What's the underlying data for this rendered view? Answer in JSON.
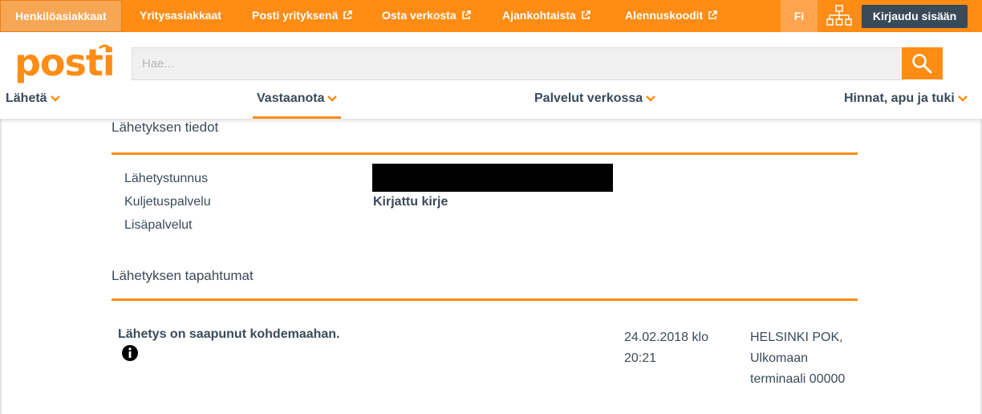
{
  "topbar": {
    "tabs": [
      {
        "label": "Henkilöasiakkaat",
        "external": false,
        "active": true
      },
      {
        "label": "Yritysasiakkaat",
        "external": false,
        "active": false
      },
      {
        "label": "Posti yrityksenä",
        "external": true,
        "active": false
      },
      {
        "label": "Osta verkosta",
        "external": true,
        "active": false
      },
      {
        "label": "Ajankohtaista",
        "external": true,
        "active": false
      },
      {
        "label": "Alennuskoodit",
        "external": true,
        "active": false
      }
    ],
    "language": "Fi",
    "sitemap_icon": "sitemap-icon",
    "login_label": "Kirjaudu sisään"
  },
  "header": {
    "logo_text": "posti",
    "search_placeholder": "Hae...",
    "search_value": "",
    "nav": [
      {
        "label": "Lähetä"
      },
      {
        "label": "Vastaanota",
        "active": true
      },
      {
        "label": "Palvelut verkossa"
      },
      {
        "label": "Hinnat, apu ja tuki"
      }
    ]
  },
  "shipment": {
    "details_title": "Lähetyksen tiedot",
    "fields": [
      {
        "label": "Lähetystunnus",
        "value": "",
        "redacted": true
      },
      {
        "label": "Kuljetuspalvelu",
        "value": "Kirjattu kirje"
      },
      {
        "label": "Lisäpalvelut",
        "value": ""
      }
    ],
    "events_title": "Lähetyksen tapahtumat",
    "events": [
      {
        "title": "Lähetys on saapunut kohdemaahan.",
        "date": "24.02.2018 klo 20:21",
        "location": "HELSINKI POK, Ulkomaan terminaali 00000"
      }
    ]
  },
  "colors": {
    "brand_orange": "#ff8c14",
    "text_dark": "#3b4a5a",
    "login_bg": "#3b4a5a"
  }
}
